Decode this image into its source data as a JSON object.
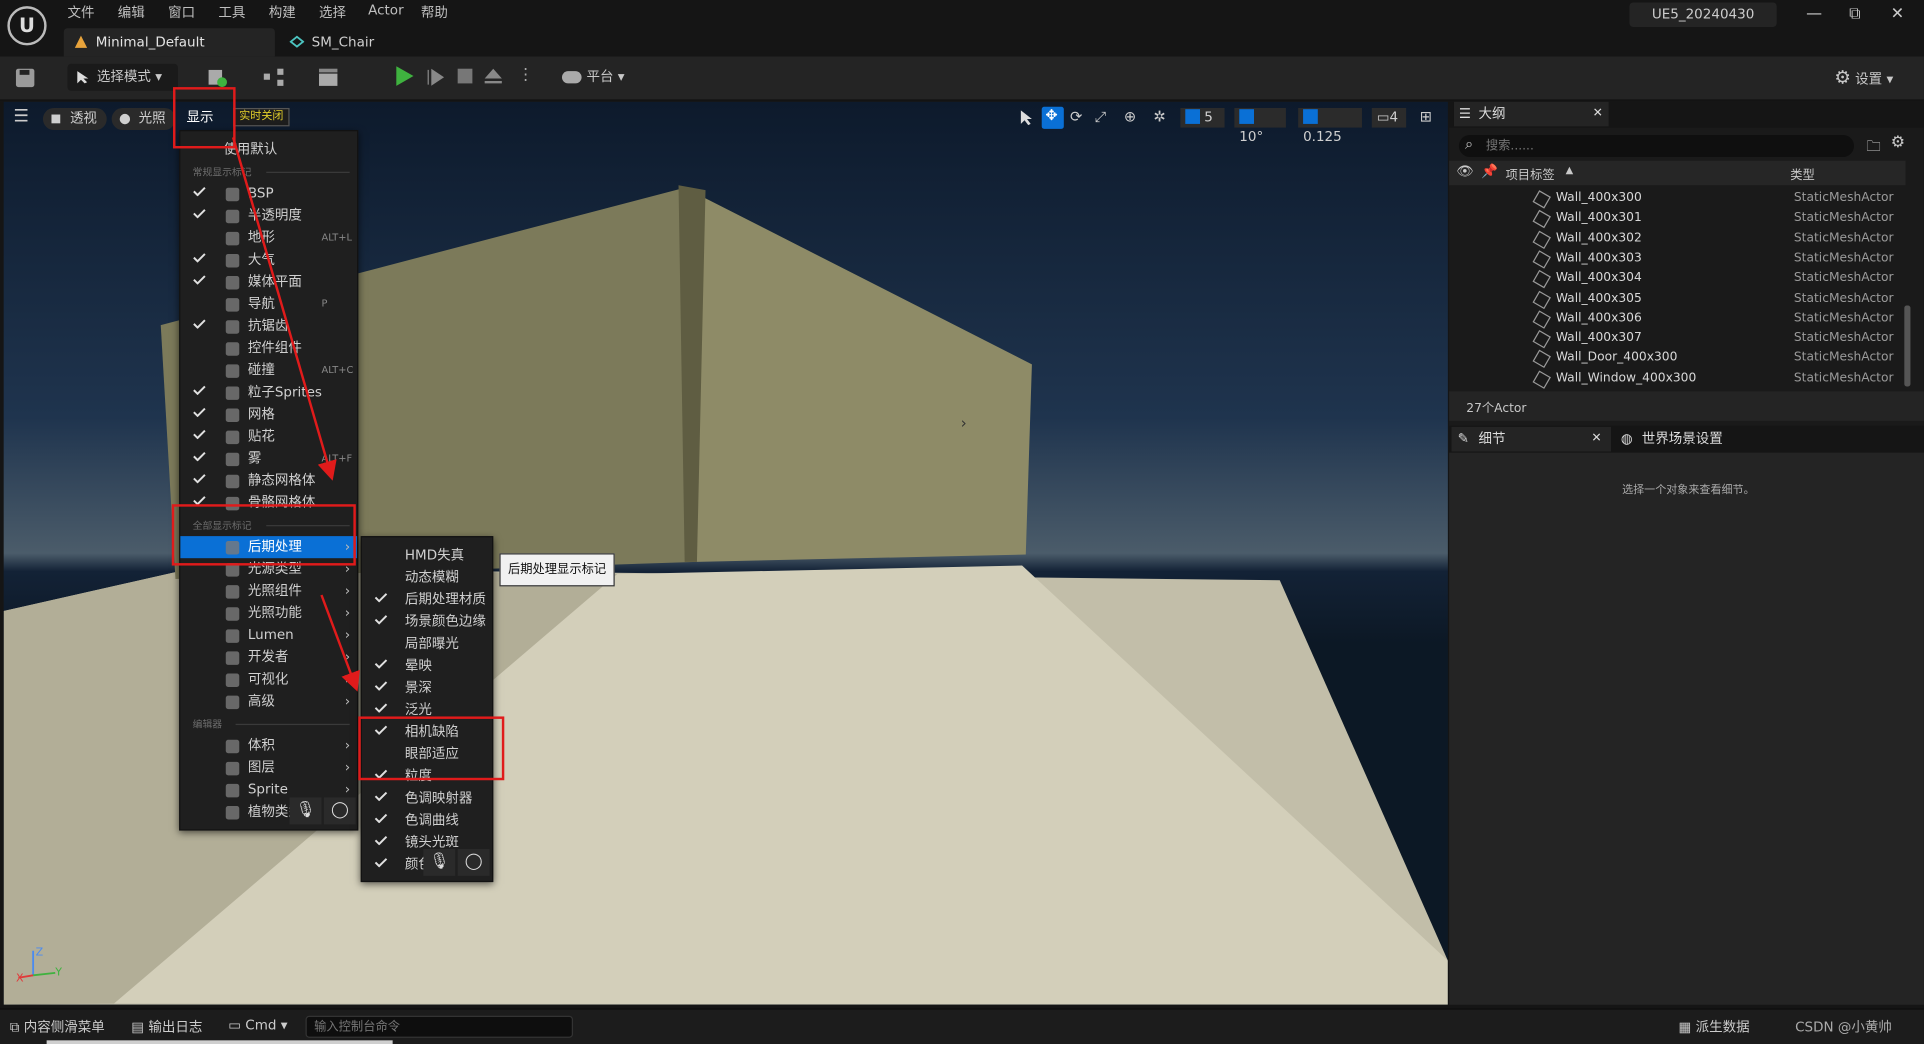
{
  "menubar": [
    "文件",
    "编辑",
    "窗口",
    "工具",
    "构建",
    "选择",
    "Actor",
    "帮助"
  ],
  "project_name": "UE5_20240430",
  "window_controls": {
    "minimize": "—",
    "restore": "⧉",
    "close": "✕"
  },
  "doc_tabs": [
    "Minimal_Default",
    "SM_Chair"
  ],
  "toolbar": {
    "mode": "选择模式",
    "platform": "平台",
    "settings": "设置"
  },
  "viewport_bar": {
    "perspective": "透视",
    "lit": "光照",
    "show": "显示",
    "realtime": "实时关闭"
  },
  "snap": {
    "grid": "5",
    "angle": "10°",
    "scale": "0.125",
    "camera_speed": "4"
  },
  "show_menu": {
    "use_default": "使用默认",
    "common_section": "常规显示标记",
    "common": [
      {
        "label": "BSP",
        "checked": true,
        "shortcut": ""
      },
      {
        "label": "半透明度",
        "checked": true,
        "shortcut": ""
      },
      {
        "label": "地形",
        "checked": false,
        "shortcut": "ALT+L"
      },
      {
        "label": "大气",
        "checked": true,
        "shortcut": ""
      },
      {
        "label": "媒体平面",
        "checked": true,
        "shortcut": ""
      },
      {
        "label": "导航",
        "checked": false,
        "shortcut": "P"
      },
      {
        "label": "抗锯齿",
        "checked": true,
        "shortcut": ""
      },
      {
        "label": "控件组件",
        "checked": false,
        "shortcut": ""
      },
      {
        "label": "碰撞",
        "checked": false,
        "shortcut": "ALT+C"
      },
      {
        "label": "粒子Sprites",
        "checked": true,
        "shortcut": ""
      },
      {
        "label": "网格",
        "checked": true,
        "shortcut": ""
      },
      {
        "label": "贴花",
        "checked": true,
        "shortcut": ""
      },
      {
        "label": "雾",
        "checked": true,
        "shortcut": "ALT+F"
      },
      {
        "label": "静态网格体",
        "checked": true,
        "shortcut": ""
      },
      {
        "label": "骨骼网格体",
        "checked": true,
        "shortcut": ""
      }
    ],
    "all_section": "全部显示标记",
    "all": [
      "后期处理",
      "光源类型",
      "光照组件",
      "光照功能",
      "Lumen",
      "开发者",
      "可视化",
      "高级"
    ],
    "editor_section": "编辑器",
    "editor": [
      "体积",
      "图层",
      "Sprite",
      "植物类型"
    ]
  },
  "post_menu": [
    {
      "label": "HMD失真",
      "checked": false
    },
    {
      "label": "动态模糊",
      "checked": false
    },
    {
      "label": "后期处理材质",
      "checked": true
    },
    {
      "label": "场景颜色边缘",
      "checked": true
    },
    {
      "label": "局部曝光",
      "checked": false
    },
    {
      "label": "晕映",
      "checked": true
    },
    {
      "label": "景深",
      "checked": true
    },
    {
      "label": "泛光",
      "checked": true
    },
    {
      "label": "相机缺陷",
      "checked": true
    },
    {
      "label": "眼部适应",
      "checked": false
    },
    {
      "label": "粒度",
      "checked": true
    },
    {
      "label": "色调映射器",
      "checked": true
    },
    {
      "label": "色调曲线",
      "checked": true
    },
    {
      "label": "镜头光斑",
      "checked": true
    },
    {
      "label": "颜色",
      "checked": true
    }
  ],
  "tooltip": "后期处理显示标记",
  "outliner": {
    "tab": "大纲",
    "search_placeholder": "搜索......",
    "col_label": "项目标签",
    "col_type": "类型",
    "rows": [
      {
        "name": "Wall_400x300",
        "type": "StaticMeshActor"
      },
      {
        "name": "Wall_400x301",
        "type": "StaticMeshActor"
      },
      {
        "name": "Wall_400x302",
        "type": "StaticMeshActor"
      },
      {
        "name": "Wall_400x303",
        "type": "StaticMeshActor"
      },
      {
        "name": "Wall_400x304",
        "type": "StaticMeshActor"
      },
      {
        "name": "Wall_400x305",
        "type": "StaticMeshActor"
      },
      {
        "name": "Wall_400x306",
        "type": "StaticMeshActor"
      },
      {
        "name": "Wall_400x307",
        "type": "StaticMeshActor"
      },
      {
        "name": "Wall_Door_400x300",
        "type": "StaticMeshActor"
      },
      {
        "name": "Wall_Window_400x300",
        "type": "StaticMeshActor"
      }
    ],
    "count": "27个Actor"
  },
  "details": {
    "tab": "细节",
    "world_tab": "世界场景设置",
    "empty": "选择一个对象来查看细节。"
  },
  "bottom": {
    "content_drawer": "内容侧滑菜单",
    "output_log": "输出日志",
    "cmd": "Cmd",
    "cmd_placeholder": "输入控制台命令",
    "derived_data": "派生数据",
    "watermark": "CSDN @小黄帅"
  },
  "colors": {
    "accent": "#0a70d6",
    "highlight_box": "#e01b1b",
    "play": "#3fb23f"
  }
}
